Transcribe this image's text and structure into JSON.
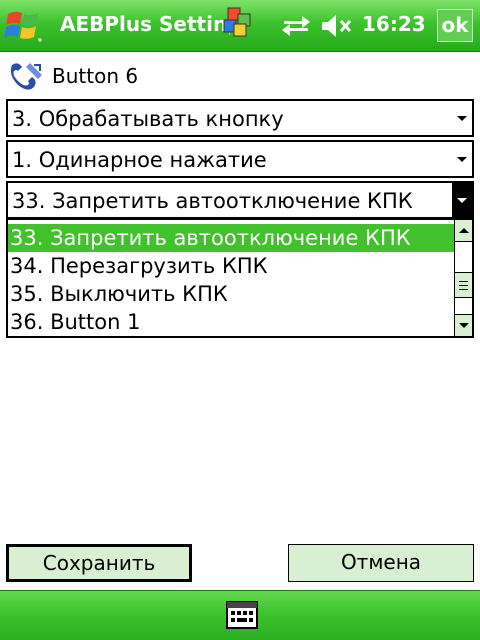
{
  "titlebar": {
    "app_title": "AEBPlus Setting",
    "clock": "16:23",
    "ok_label": "ok",
    "icons": [
      "windows-start-icon",
      "tray-app-icon",
      "sync-icon",
      "volume-icon"
    ]
  },
  "header": {
    "title": "Button 6",
    "icon": "button-settings-icon"
  },
  "combos": {
    "action_mode": {
      "selected": "3. Обрабатывать кнопку"
    },
    "press_type": {
      "selected": "1. Одинарное нажатие"
    },
    "command": {
      "selected": "33. Запретить автоотключение КПК"
    }
  },
  "dropdown": {
    "items": [
      {
        "label": "33. Запретить автоотключение КПК",
        "selected": true
      },
      {
        "label": "34. Перезагрузить КПК",
        "selected": false
      },
      {
        "label": "35. Выключить КПК",
        "selected": false
      },
      {
        "label": "36. Button 1",
        "selected": false
      }
    ]
  },
  "buttons": {
    "save_label": "Сохранить",
    "cancel_label": "Отмена"
  },
  "bottombar": {
    "icon": "keyboard-sip-icon"
  },
  "colors": {
    "bar_green": "#3cc22c",
    "selection_green": "#41c12b",
    "button_bg": "#d8efd2"
  }
}
